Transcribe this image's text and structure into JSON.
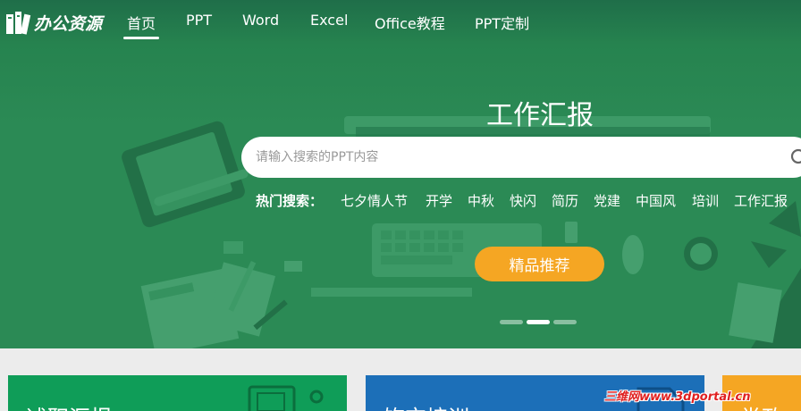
{
  "nav": {
    "logo_text": "办公资源",
    "items": [
      {
        "label": "首页",
        "active": true
      },
      {
        "label": "PPT"
      },
      {
        "label": "Word"
      },
      {
        "label": "Excel"
      },
      {
        "label": "Office教程"
      },
      {
        "label": "PPT定制"
      }
    ]
  },
  "hero": {
    "title": "工作汇报",
    "search": {
      "placeholder": "请输入搜索的PPT内容",
      "value": ""
    },
    "hot_label": "热门搜索：",
    "hot_tags": [
      "七夕情人节",
      "开学",
      "中秋",
      "快闪",
      "简历",
      "党建",
      "中国风",
      "培训",
      "工作汇报"
    ],
    "featured_button": "精品推荐",
    "slides": {
      "count": 3,
      "active_index": 1
    }
  },
  "cards": [
    {
      "title": "述职汇报",
      "color": "#0f9d58"
    },
    {
      "title": "饰交培训",
      "color": "#1c6fb8"
    },
    {
      "title": "党政",
      "color": "#f5a623"
    }
  ],
  "watermark": "三维网www.3dportal.cn",
  "colors": {
    "hero_green": "#2b8a55",
    "accent_orange": "#f5a623"
  }
}
